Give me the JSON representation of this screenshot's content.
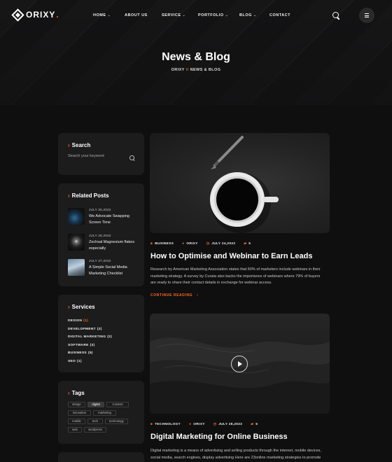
{
  "brand": {
    "name": "ORIXY",
    "dot": "."
  },
  "nav": {
    "items": [
      {
        "label": "HOME",
        "has_dropdown": true
      },
      {
        "label": "ABOUT US",
        "has_dropdown": false
      },
      {
        "label": "SERVICE",
        "has_dropdown": true
      },
      {
        "label": "PORTFOLIO",
        "has_dropdown": true
      },
      {
        "label": "BLOG",
        "has_dropdown": true
      },
      {
        "label": "CONTACT",
        "has_dropdown": false
      }
    ]
  },
  "hero": {
    "title": "News & Blog",
    "breadcrumb": {
      "home": "ORIXY",
      "separator": "//",
      "current": "NEWS & BLOG"
    }
  },
  "sidebar": {
    "search": {
      "title": "Search",
      "placeholder": "Search your keyword"
    },
    "related": {
      "title": "Related Posts",
      "posts": [
        {
          "date": "JULY 25,2022",
          "title": "We Advocate Swapping Screen Time"
        },
        {
          "date": "JULY 28,2022",
          "title": "Zechsal Magnesium flakes especially"
        },
        {
          "date": "JULY 27,2022",
          "title": "A Simple Social Media Marketing Checklist"
        }
      ]
    },
    "services": {
      "title": "Services",
      "items": [
        {
          "label": "DESIGN",
          "count": "(1)"
        },
        {
          "label": "DEVELOPMENT",
          "count": "(2)"
        },
        {
          "label": "DIGITAL MARKETING",
          "count": "(2)"
        },
        {
          "label": "SOFTWARE",
          "count": "(3)"
        },
        {
          "label": "BUSINESS",
          "count": "(5)"
        },
        {
          "label": "SEO",
          "count": "(1)"
        }
      ]
    },
    "tags": {
      "title": "Tags",
      "items": [
        "design",
        "digital",
        "Content",
        "innovation",
        "marketing",
        "mobile",
        "tech",
        "technology",
        "web",
        "wordpress"
      ]
    }
  },
  "articles": [
    {
      "category": "BUSINESS",
      "author": "ORIXY",
      "date": "JULY 24,2022",
      "comments": "5",
      "title": "How to Optimise and Webinar to Earn Leads",
      "excerpt": "Research by American Marketing Association states that 60% of marketers include webinars in their marketing strategy. A survey by Curata also backs the importance of webinars where 79% of buyers are ready to share their contact details in exchange for webinar access.",
      "read_more": "CONTINUE READING"
    },
    {
      "category": "TECHNOLOGY",
      "author": "ORIXY",
      "date": "JULY 28,2022",
      "comments": "5",
      "title": "Digital Marketing for Online Business",
      "excerpt": "Digital marketing is a means of advertising and selling products through the internet, mobile devices, social media, search engines, display advertising Here are 23online marketing strategies to promote"
    }
  ],
  "colors": {
    "accent": "#ff6b1a",
    "background": "#0f0f10",
    "card": "#1c1c1d"
  }
}
